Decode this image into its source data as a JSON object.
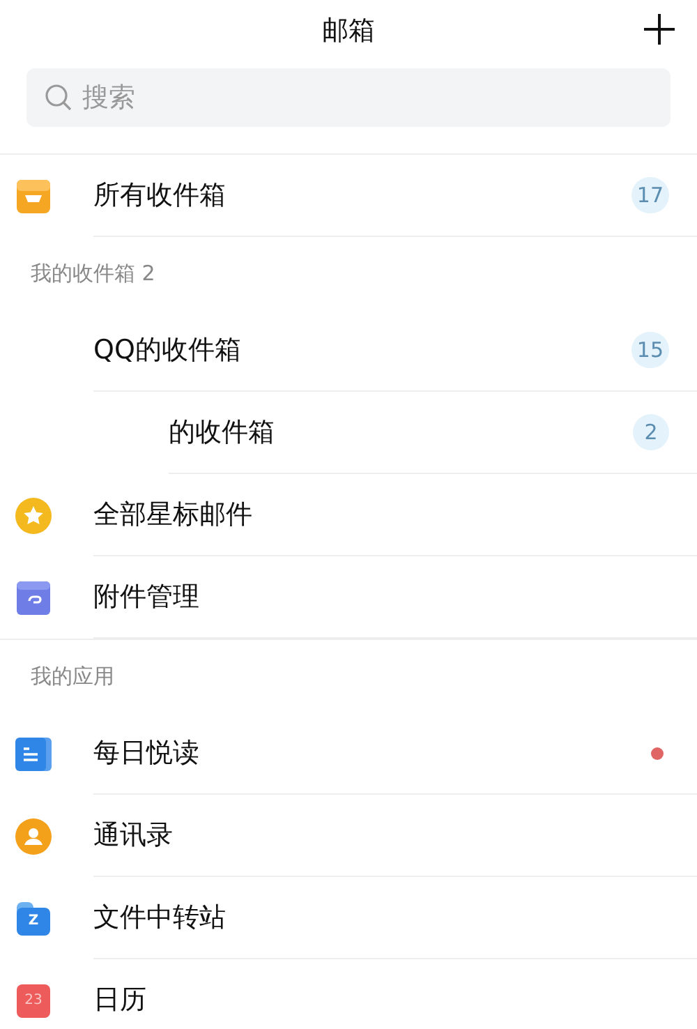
{
  "header": {
    "title": "邮箱"
  },
  "search": {
    "placeholder": "搜索"
  },
  "top_items": [
    {
      "kind": "tray",
      "label": "所有收件箱",
      "count": "17"
    }
  ],
  "sections": [
    {
      "title": "我的收件箱 2",
      "items": [
        {
          "kind": "account",
          "label": "QQ的收件箱",
          "count": "15",
          "children": [
            {
              "label": "的收件箱",
              "count": "2"
            }
          ]
        },
        {
          "kind": "star",
          "label": "全部星标邮件"
        },
        {
          "kind": "clip",
          "label": "附件管理"
        }
      ]
    },
    {
      "title": "我的应用",
      "items": [
        {
          "kind": "doc",
          "label": "每日悦读",
          "unread": true
        },
        {
          "kind": "contact",
          "label": "通讯录",
          "unread": false
        },
        {
          "kind": "folder",
          "label": "文件中转站",
          "icon_text": "Z"
        },
        {
          "kind": "calendar",
          "label": "日历",
          "icon_text": "23"
        }
      ]
    }
  ]
}
